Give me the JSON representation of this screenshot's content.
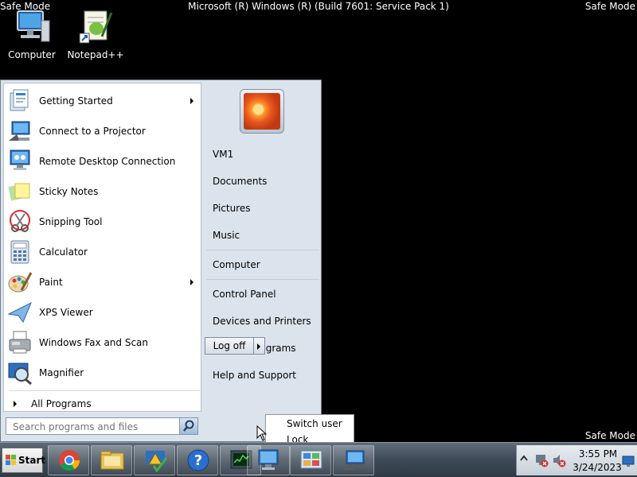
{
  "screen": {
    "safe_mode_label": "Safe Mode",
    "system_title": "Microsoft (R) Windows (R) (Build 7601: Service Pack 1)"
  },
  "desktop": {
    "icons": [
      {
        "label": "Computer",
        "icon": "computer-icon"
      },
      {
        "label": "Notepad++",
        "icon": "notepadpp-icon"
      }
    ]
  },
  "start_menu": {
    "programs": [
      {
        "label": "Getting Started",
        "icon": "getting-started-icon",
        "has_submenu": true
      },
      {
        "label": "Connect to a Projector",
        "icon": "projector-icon",
        "has_submenu": false
      },
      {
        "label": "Remote Desktop Connection",
        "icon": "remote-desktop-icon",
        "has_submenu": false
      },
      {
        "label": "Sticky Notes",
        "icon": "sticky-notes-icon",
        "has_submenu": false
      },
      {
        "label": "Snipping Tool",
        "icon": "snipping-tool-icon",
        "has_submenu": false
      },
      {
        "label": "Calculator",
        "icon": "calculator-icon",
        "has_submenu": false
      },
      {
        "label": "Paint",
        "icon": "paint-icon",
        "has_submenu": true
      },
      {
        "label": "XPS Viewer",
        "icon": "xps-viewer-icon",
        "has_submenu": false
      },
      {
        "label": "Windows Fax and Scan",
        "icon": "fax-scan-icon",
        "has_submenu": false
      },
      {
        "label": "Magnifier",
        "icon": "magnifier-icon",
        "has_submenu": false
      }
    ],
    "all_programs": "All Programs",
    "search_placeholder": "Search programs and files",
    "right_items": {
      "user": "VM1",
      "documents": "Documents",
      "pictures": "Pictures",
      "music": "Music",
      "computer": "Computer",
      "control_panel": "Control Panel",
      "devices_printers": "Devices and Printers",
      "default_programs": "Default Programs",
      "help_support": "Help and Support"
    },
    "logoff": "Log off",
    "power_menu": {
      "switch_user": "Switch user",
      "lock": "Lock"
    }
  },
  "taskbar": {
    "start_label": "Start",
    "pinned": [
      {
        "icon": "chrome-icon"
      },
      {
        "icon": "explorer-icon"
      },
      {
        "icon": "action-center-icon"
      },
      {
        "icon": "help-icon"
      },
      {
        "icon": "task-manager-icon"
      },
      {
        "icon": "remote-desktop-icon"
      },
      {
        "icon": "control-panel-icon"
      },
      {
        "icon": "projector-icon"
      }
    ],
    "clock_time": "3:55 PM",
    "clock_date": "3/24/2023"
  },
  "colors": {
    "desktop_bg": "#000000",
    "menu_bg": "#dbe3ec",
    "taskbar_bg": "#3f4c59",
    "accent": "#1f6fc5"
  }
}
